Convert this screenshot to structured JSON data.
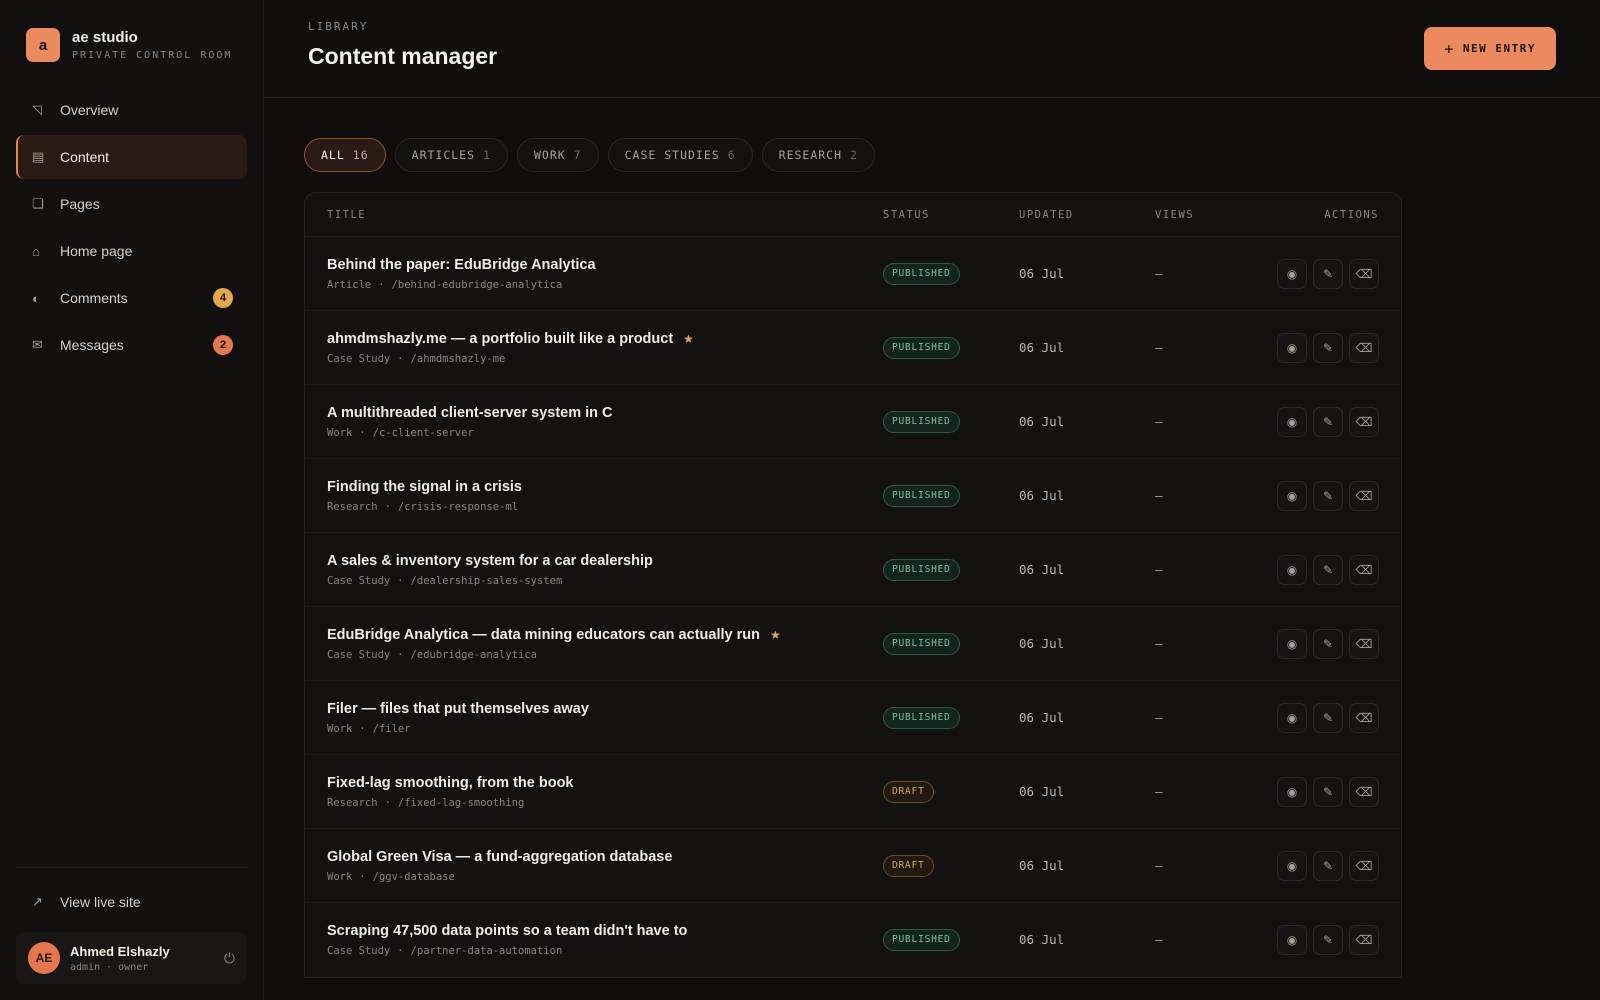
{
  "brand": {
    "logo_letter": "a",
    "name": "ae studio",
    "subtitle": "PRIVATE CONTROL ROOM"
  },
  "nav": [
    {
      "label": "Overview",
      "icon": "◹",
      "icon_name": "overview-icon"
    },
    {
      "label": "Content",
      "icon": "▤",
      "icon_name": "content-icon",
      "active": true
    },
    {
      "label": "Pages",
      "icon": "❏",
      "icon_name": "pages-icon"
    },
    {
      "label": "Home page",
      "icon": "⌂",
      "icon_name": "home-icon"
    },
    {
      "label": "Comments",
      "icon": "◐",
      "icon_name": "comments-icon",
      "badge": "4"
    },
    {
      "label": "Messages",
      "icon": "✉",
      "icon_name": "mail-icon",
      "badge": "2"
    }
  ],
  "sidebar_footer": {
    "live_icon": "↗",
    "live_label": "View live site",
    "user": {
      "initials": "AE",
      "name": "Ahmed Elshazly",
      "role": "admin · owner"
    },
    "power_icon": "⏻"
  },
  "header": {
    "eyebrow": "LIBRARY",
    "title": "Content manager",
    "new_icon": "+",
    "new_label": "NEW ENTRY"
  },
  "filters": [
    {
      "label": "ALL",
      "count": "16",
      "active": true
    },
    {
      "label": "ARTICLES",
      "count": "1"
    },
    {
      "label": "WORK",
      "count": "7"
    },
    {
      "label": "CASE STUDIES",
      "count": "6"
    },
    {
      "label": "RESEARCH",
      "count": "2"
    }
  ],
  "table": {
    "columns": {
      "title": "TITLE",
      "status": "STATUS",
      "updated": "UPDATED",
      "views": "VIEWS",
      "actions": "ACTIONS"
    },
    "action_icons": {
      "view": "◉",
      "edit": "✎",
      "delete": "⌫"
    },
    "rows": [
      {
        "title": "Behind the paper: EduBridge Analytica",
        "type": "Article",
        "slug": "/behind-edubridge-analytica",
        "status": "PUBLISHED",
        "updated": "06 Jul",
        "views": "—",
        "starred": false
      },
      {
        "title": "ahmdmshazly.me — a portfolio built like a product",
        "type": "Case Study",
        "slug": "/ahmdmshazly-me",
        "status": "PUBLISHED",
        "updated": "06 Jul",
        "views": "—",
        "starred": true
      },
      {
        "title": "A multithreaded client-server system in C",
        "type": "Work",
        "slug": "/c-client-server",
        "status": "PUBLISHED",
        "updated": "06 Jul",
        "views": "—",
        "starred": false
      },
      {
        "title": "Finding the signal in a crisis",
        "type": "Research",
        "slug": "/crisis-response-ml",
        "status": "PUBLISHED",
        "updated": "06 Jul",
        "views": "—",
        "starred": false
      },
      {
        "title": "A sales & inventory system for a car dealership",
        "type": "Case Study",
        "slug": "/dealership-sales-system",
        "status": "PUBLISHED",
        "updated": "06 Jul",
        "views": "—",
        "starred": false
      },
      {
        "title": "EduBridge Analytica — data mining educators can actually run",
        "type": "Case Study",
        "slug": "/edubridge-analytica",
        "status": "PUBLISHED",
        "updated": "06 Jul",
        "views": "—",
        "starred": true
      },
      {
        "title": "Filer — files that put themselves away",
        "type": "Work",
        "slug": "/filer",
        "status": "PUBLISHED",
        "updated": "06 Jul",
        "views": "—",
        "starred": false
      },
      {
        "title": "Fixed-lag smoothing, from the book",
        "type": "Research",
        "slug": "/fixed-lag-smoothing",
        "status": "DRAFT",
        "updated": "06 Jul",
        "views": "—",
        "starred": false
      },
      {
        "title": "Global Green Visa — a fund-aggregation database",
        "type": "Work",
        "slug": "/ggv-database",
        "status": "DRAFT",
        "updated": "06 Jul",
        "views": "—",
        "starred": false
      },
      {
        "title": "Scraping 47,500 data points so a team didn't have to",
        "type": "Case Study",
        "slug": "/partner-data-automation",
        "status": "PUBLISHED",
        "updated": "06 Jul",
        "views": "—",
        "starred": false
      }
    ]
  },
  "meta_separator": "·",
  "star_icon": "★",
  "colors": {
    "accent": "#ea8a5e",
    "published": "#79c3a0",
    "draft": "#d8a55a",
    "background": "#0f0e0d"
  }
}
